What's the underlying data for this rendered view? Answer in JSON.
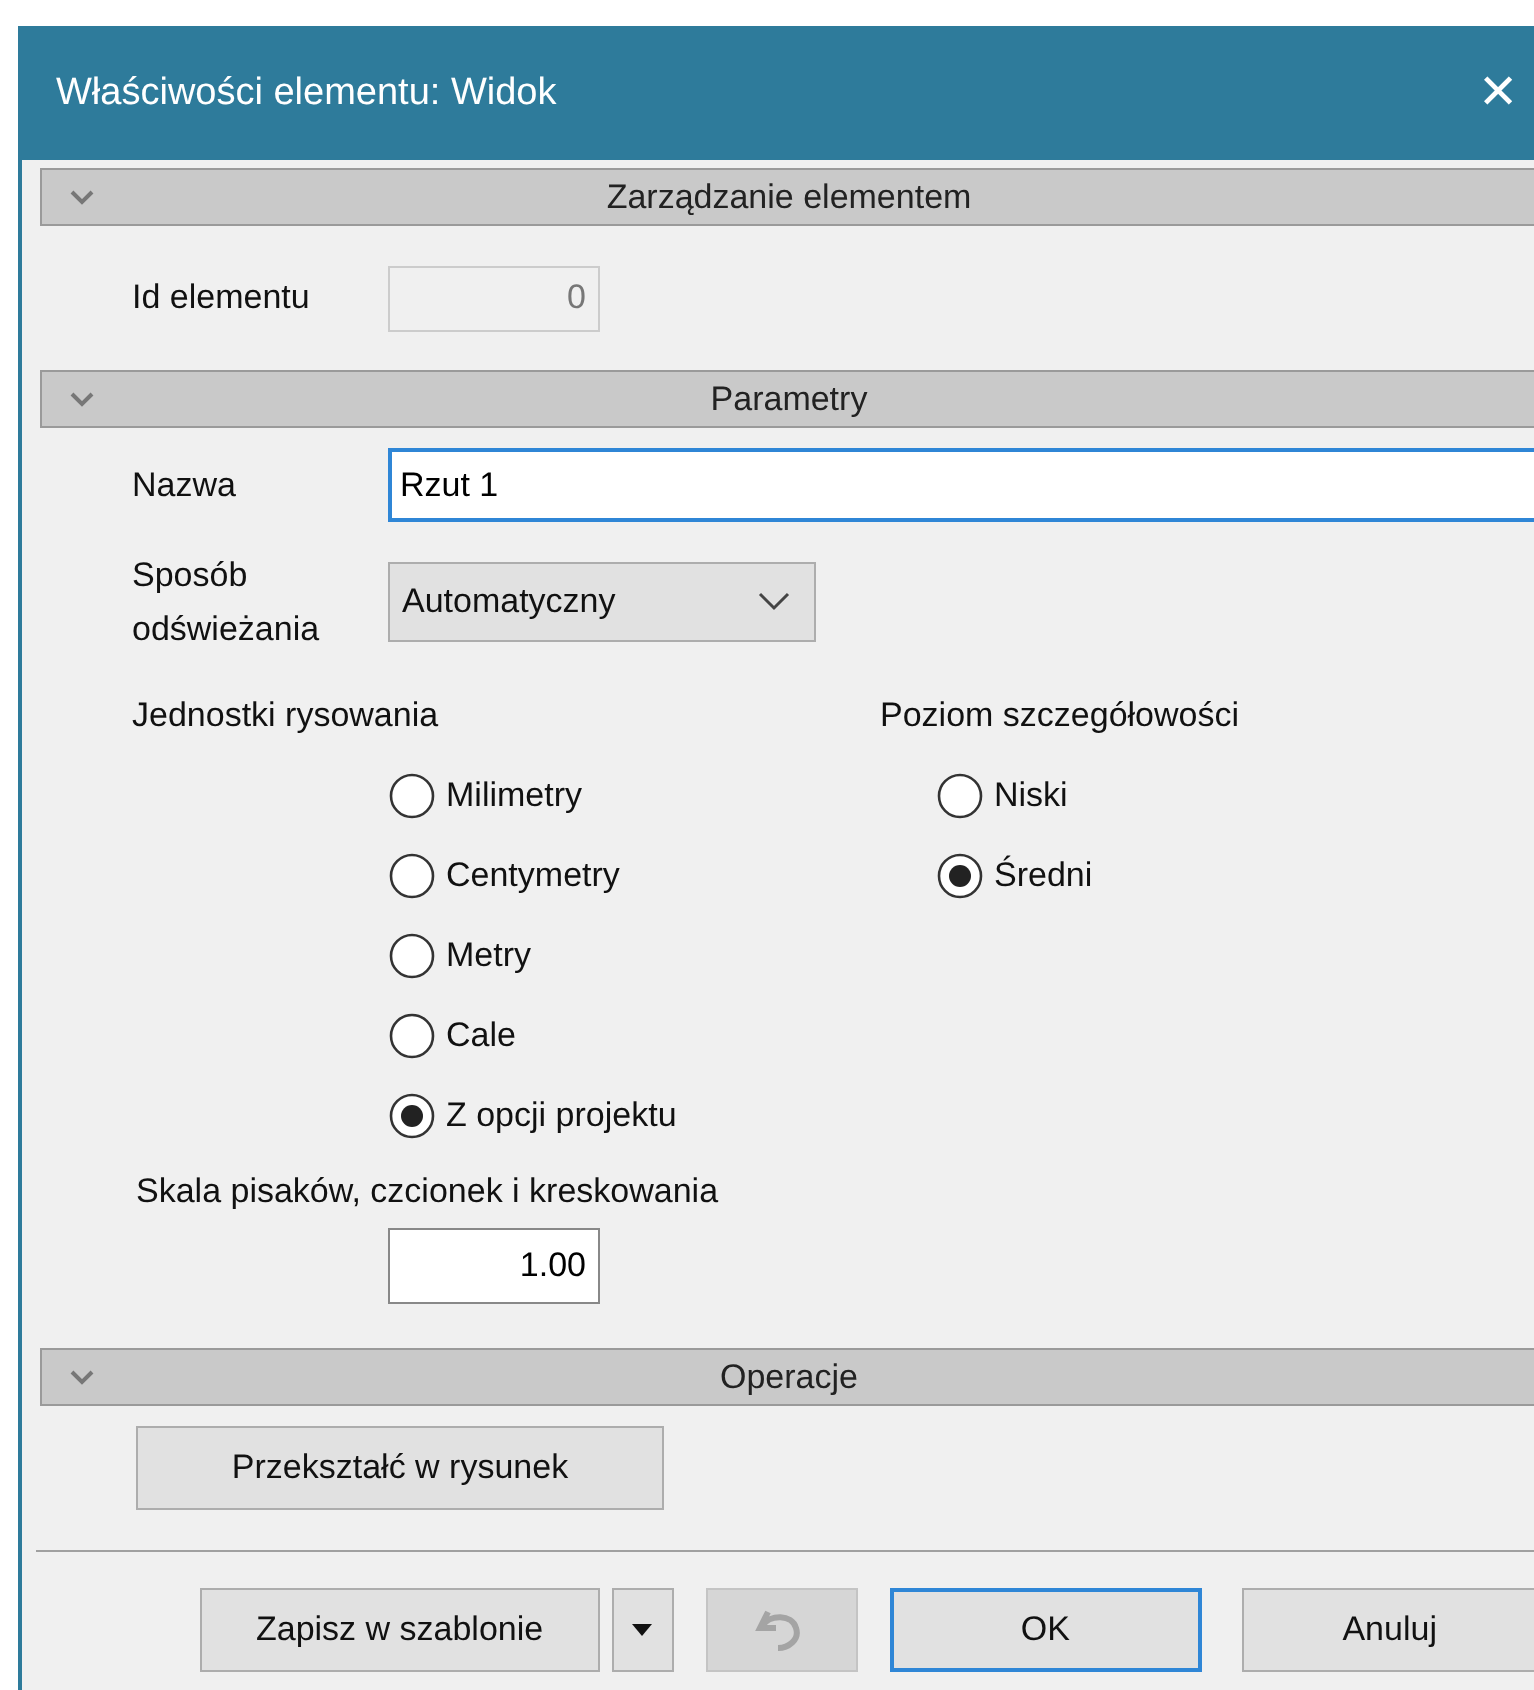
{
  "window": {
    "title": "Właściwości elementu: Widok",
    "close": "✕"
  },
  "sections": [
    {
      "title": "Zarządzanie elementem",
      "expanded": true
    },
    {
      "title": "Parametry",
      "expanded": true
    },
    {
      "title": "Operacje",
      "expanded": true
    }
  ],
  "element_id": {
    "label": "Id elementu",
    "value": "0",
    "disabled": true
  },
  "name": {
    "label": "Nazwa",
    "value": "Rzut 1",
    "focused": true
  },
  "refresh": {
    "label": "Sposób odświeżania",
    "value": "Automatyczny"
  },
  "units": {
    "label": "Jednostki rysowania",
    "options": [
      {
        "label": "Milimetry",
        "selected": false
      },
      {
        "label": "Centymetry",
        "selected": false
      },
      {
        "label": "Metry",
        "selected": false
      },
      {
        "label": "Cale",
        "selected": false
      },
      {
        "label": "Z opcji projektu",
        "selected": true
      }
    ]
  },
  "detail": {
    "label": "Poziom szczegółowości",
    "options": [
      {
        "label": "Niski",
        "selected": false
      },
      {
        "label": "Średni",
        "selected": true
      }
    ]
  },
  "scale": {
    "label": "Skala pisaków, czcionek i kreskowania",
    "value": "1.00"
  },
  "convert_button": "Przekształć w rysunek",
  "footer": {
    "save_template": "Zapisz w szablonie",
    "undo_disabled": true,
    "ok": "OK",
    "ok_default": true,
    "cancel": "Anuluj"
  }
}
